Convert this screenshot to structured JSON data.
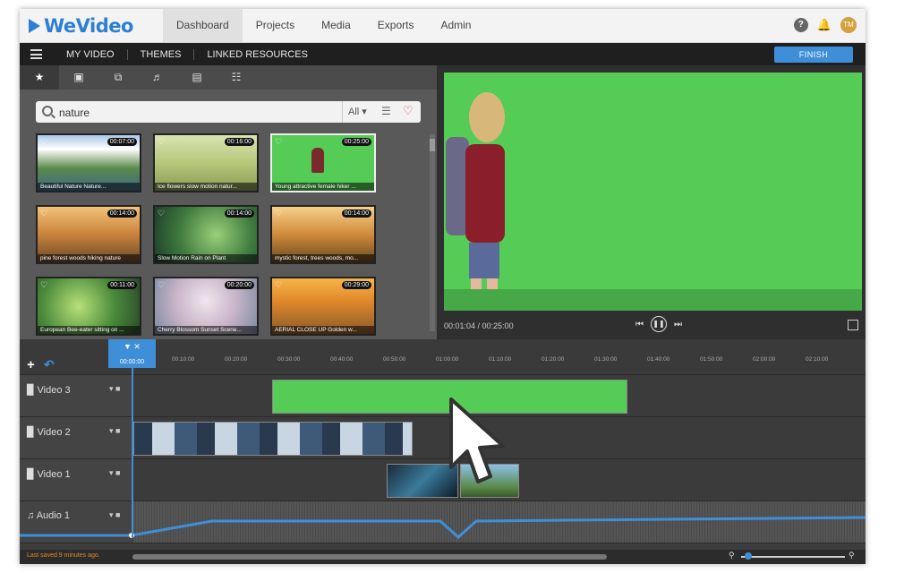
{
  "app": {
    "logo_text": "WeVideo",
    "nav_tabs": [
      "Dashboard",
      "Projects",
      "Media",
      "Exports",
      "Admin"
    ],
    "help_icon": "?",
    "avatar_initials": "TM"
  },
  "subbar": {
    "items": [
      "MY VIDEO",
      "THEMES",
      "LINKED RESOURCES"
    ],
    "finish_label": "FINISH"
  },
  "library": {
    "search_value": "nature",
    "filter_label": "All",
    "thumbnails": [
      {
        "duration": "00:07:00",
        "caption": "Beautiful Nature Nature..."
      },
      {
        "duration": "00:16:00",
        "caption": "Ice flowers slow motion natur..."
      },
      {
        "duration": "00:25:00",
        "caption": "Young attractive female hiker ..."
      },
      {
        "duration": "00:14:00",
        "caption": "pine forest woods hiking nature"
      },
      {
        "duration": "00:14:00",
        "caption": "Slow Motion Rain on Plant"
      },
      {
        "duration": "00:14:00",
        "caption": "mystic forest, trees woods, mo..."
      },
      {
        "duration": "00:11:00",
        "caption": "European Bee-eater sitting on ..."
      },
      {
        "duration": "00:20:00",
        "caption": "Cherry Blossom Sunset Scene..."
      },
      {
        "duration": "00:29:00",
        "caption": "AERIAL CLOSE UP Golden w..."
      }
    ]
  },
  "preview": {
    "time": "00:01:04 / 00:25:00"
  },
  "timeline": {
    "playhead_time": "00:00:00",
    "ticks": [
      "00:10:00",
      "00:20:00",
      "00:30:00",
      "00:40:00",
      "00:50:00",
      "01:00:00",
      "01:10:00",
      "01:20:00",
      "01:30:00",
      "01:40:00",
      "01:50:00",
      "02:00:00",
      "02:10:00"
    ],
    "tracks": [
      "Video 3",
      "Video 2",
      "Video 1",
      "Audio 1"
    ]
  },
  "status": {
    "saved_text": "Last saved 9 minutes ago."
  },
  "colors": {
    "accent": "#3e8fd8",
    "green_screen": "#55cc55",
    "saved_text": "#e08a2c"
  },
  "icons": [
    "wevideo-logo-icon",
    "help-icon",
    "bell-icon",
    "hamburger-icon",
    "star-icon",
    "folder-icon",
    "search-icon",
    "heart-icon",
    "filter-icon",
    "play-icon",
    "pause-icon",
    "fullscreen-icon",
    "add-icon",
    "undo-icon",
    "cursor-icon",
    "zoom-icon"
  ]
}
